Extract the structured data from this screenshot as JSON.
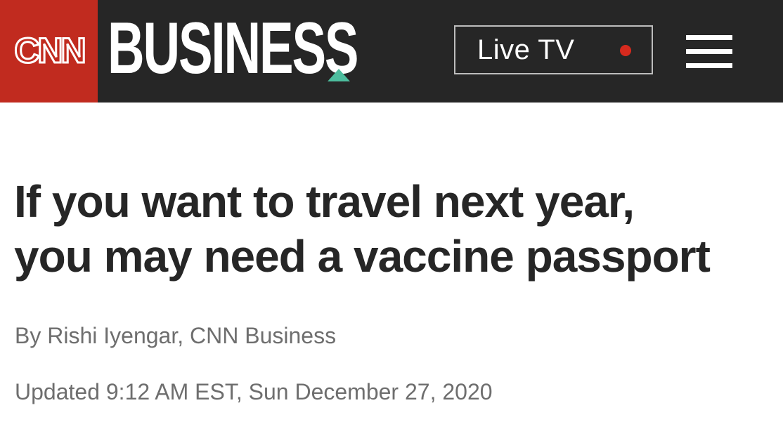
{
  "header": {
    "logo_text": "CNN",
    "section_title": "BUSINESS",
    "live_tv_label": "Live TV",
    "menu_icon": "hamburger-menu-icon"
  },
  "article": {
    "headline_line1": "If you want to travel next year,",
    "headline_line2": "you may need a vaccine passport",
    "byline": "By Rishi Iyengar, CNN Business",
    "timestamp": "Updated 9:12 AM EST, Sun December 27, 2020"
  },
  "colors": {
    "header_background": "#262626",
    "logo_background": "#c12b1f",
    "business_accent": "#4dbd9e",
    "live_dot": "#d62a1e",
    "headline_text": "#262626",
    "meta_text": "#6e6e6e"
  }
}
